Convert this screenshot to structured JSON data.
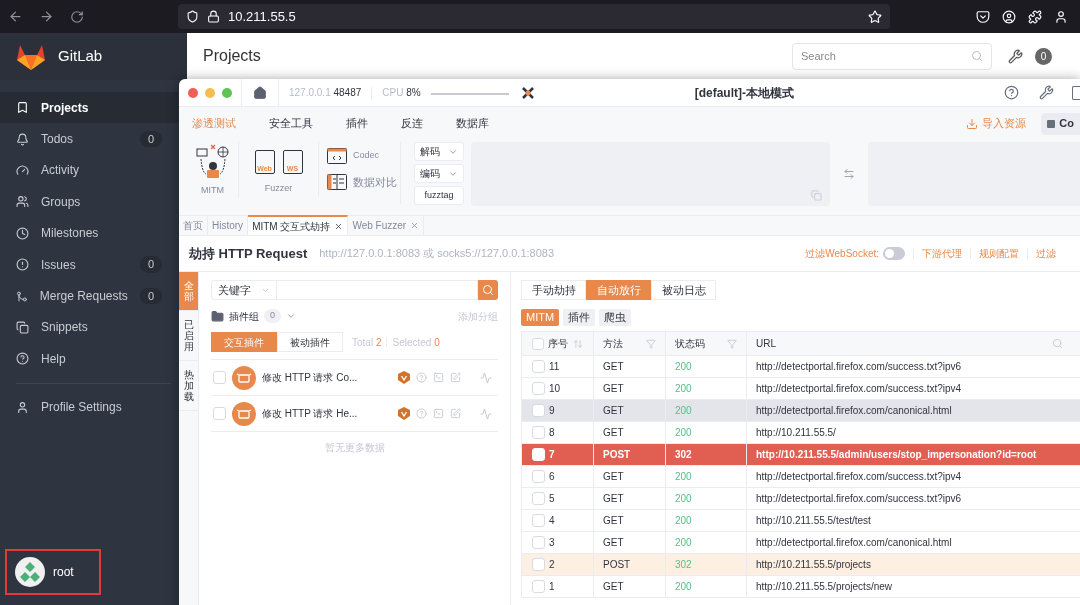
{
  "browser": {
    "url": "10.211.55.5"
  },
  "gitlab": {
    "logo_text": "GitLab",
    "page_title": "Projects",
    "search_placeholder": "Search",
    "badge": "0",
    "user": "root",
    "sidebar": [
      {
        "label": "Projects",
        "selected": true
      },
      {
        "label": "Todos",
        "count": "0",
        "selected": false
      },
      {
        "label": "Activity",
        "selected": false
      },
      {
        "label": "Groups",
        "selected": false
      },
      {
        "label": "Milestones",
        "selected": false
      },
      {
        "label": "Issues",
        "count": "0",
        "selected": false
      },
      {
        "label": "Merge Requests",
        "count": "0",
        "selected": false
      },
      {
        "label": "Snippets",
        "selected": false
      },
      {
        "label": "Help",
        "selected": false
      }
    ],
    "profile": "Profile Settings"
  },
  "yakit": {
    "address": "127.0.0.1",
    "port": "48487",
    "cpu_label": "CPU",
    "cpu": "8%",
    "title": "[default]-本地模式",
    "menu": [
      {
        "label": "渗透测试",
        "selected": true
      },
      {
        "label": "安全工具",
        "selected": false
      },
      {
        "label": "插件",
        "selected": false
      },
      {
        "label": "反连",
        "selected": false
      },
      {
        "label": "数据库",
        "selected": false
      }
    ],
    "import_label": "导入资源",
    "cut_button": "Co",
    "mitm_label": "MITM",
    "fuzzer_label": "Fuzzer",
    "web_label": "Web",
    "ws_label": "WS",
    "codec_label": "Codec",
    "compare_label": "数据对比",
    "decode_label": "解码",
    "encode_label": "编码",
    "fuzztag_label": "fuzztag",
    "tabs": [
      {
        "label": "首页",
        "selected": false,
        "closable": false
      },
      {
        "label": "History",
        "selected": false,
        "closable": false
      },
      {
        "label": "MITM 交互式劫持",
        "selected": true,
        "closable": true
      },
      {
        "label": "Web Fuzzer",
        "selected": false,
        "closable": true
      }
    ],
    "heading": "劫持 HTTP Request",
    "proxy_hint": "http://127.0.0.1:8083 或 socks5://127.0.0.1:8083",
    "filter_ws_label": "过滤WebSocket:",
    "filter_ws_on": false,
    "links": [
      "下游代理",
      "规则配置",
      "过滤"
    ],
    "side_tabs": [
      {
        "label": "全部",
        "selected": true
      },
      {
        "label": "已启用",
        "selected": false
      },
      {
        "label": "热加载",
        "selected": false
      }
    ],
    "keyword_select": "关键字",
    "plugin_group_label": "插件组",
    "plugin_group_count": "0",
    "add_group": "添加分组",
    "plugin_tabs": [
      {
        "label": "交互插件",
        "selected": true
      },
      {
        "label": "被动插件",
        "selected": false
      }
    ],
    "total_label": "Total",
    "total": "2",
    "selected_label": "Selected",
    "selected_count": "0",
    "plugins": [
      {
        "name": "修改 HTTP 请求 Co...",
        "checked": false
      },
      {
        "name": "修改 HTTP 请求 He...",
        "checked": false
      }
    ],
    "no_more": "暂无更多数据",
    "mode_tabs": [
      {
        "label": "手动劫持",
        "selected": false
      },
      {
        "label": "自动放行",
        "selected": true
      },
      {
        "label": "被动日志",
        "selected": false
      }
    ],
    "source_tags": [
      {
        "label": "MITM",
        "selected": true
      },
      {
        "label": "插件",
        "selected": false
      },
      {
        "label": "爬虫",
        "selected": false
      }
    ],
    "table": {
      "columns": [
        "序号",
        "方法",
        "状态码",
        "URL"
      ],
      "rows": [
        {
          "id": "11",
          "method": "GET",
          "status": "200",
          "url": "http://detectportal.firefox.com/success.txt?ipv6",
          "checked": false,
          "flagged": false,
          "marked": false,
          "hovered": false
        },
        {
          "id": "10",
          "method": "GET",
          "status": "200",
          "url": "http://detectportal.firefox.com/success.txt?ipv4",
          "checked": false,
          "flagged": false,
          "marked": false,
          "hovered": false
        },
        {
          "id": "9",
          "method": "GET",
          "status": "200",
          "url": "http://detectportal.firefox.com/canonical.html",
          "checked": false,
          "flagged": false,
          "marked": false,
          "hovered": true
        },
        {
          "id": "8",
          "method": "GET",
          "status": "200",
          "url": "http://10.211.55.5/",
          "checked": false,
          "flagged": false,
          "marked": false,
          "hovered": false
        },
        {
          "id": "7",
          "method": "POST",
          "status": "302",
          "url": "http://10.211.55.5/admin/users/stop_impersonation?id=root",
          "checked": false,
          "flagged": true,
          "marked": false,
          "hovered": false
        },
        {
          "id": "6",
          "method": "GET",
          "status": "200",
          "url": "http://detectportal.firefox.com/success.txt?ipv4",
          "checked": false,
          "flagged": false,
          "marked": false,
          "hovered": false
        },
        {
          "id": "5",
          "method": "GET",
          "status": "200",
          "url": "http://detectportal.firefox.com/success.txt?ipv6",
          "checked": false,
          "flagged": false,
          "marked": false,
          "hovered": false
        },
        {
          "id": "4",
          "method": "GET",
          "status": "200",
          "url": "http://10.211.55.5/test/test",
          "checked": false,
          "flagged": false,
          "marked": false,
          "hovered": false
        },
        {
          "id": "3",
          "method": "GET",
          "status": "200",
          "url": "http://detectportal.firefox.com/canonical.html",
          "checked": false,
          "flagged": false,
          "marked": false,
          "hovered": false
        },
        {
          "id": "2",
          "method": "POST",
          "status": "302",
          "url": "http://10.211.55.5/projects",
          "checked": false,
          "flagged": false,
          "marked": true,
          "hovered": false
        },
        {
          "id": "1",
          "method": "GET",
          "status": "200",
          "url": "http://10.211.55.5/projects/new",
          "checked": false,
          "flagged": false,
          "marked": false,
          "hovered": false
        }
      ]
    }
  }
}
